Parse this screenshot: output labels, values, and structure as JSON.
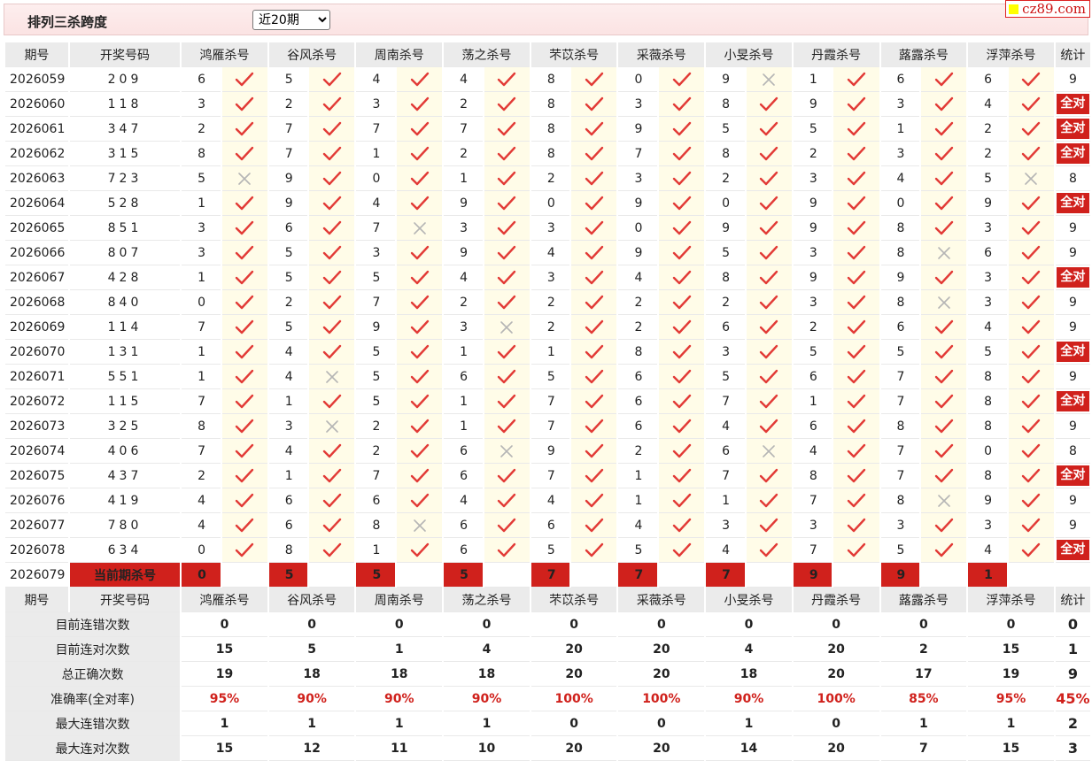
{
  "header": {
    "title": "排列三杀跨度",
    "period_select": "近20期",
    "logo_text": "cz89.com"
  },
  "columns": {
    "period": "期号",
    "open": "开奖号码",
    "experts": [
      "鸿雁杀号",
      "谷风杀号",
      "周南杀号",
      "荡之杀号",
      "芣苡杀号",
      "采薇杀号",
      "小旻杀号",
      "丹霞杀号",
      "蕗露杀号",
      "浮萍杀号"
    ],
    "stat": "统计"
  },
  "rows": [
    {
      "period": "2026059",
      "open": "209",
      "nums": [
        "6",
        "5",
        "4",
        "4",
        "8",
        "0",
        "9",
        "1",
        "6",
        "6"
      ],
      "ok": [
        1,
        1,
        1,
        1,
        1,
        1,
        0,
        1,
        1,
        1
      ],
      "stat": "9"
    },
    {
      "period": "2026060",
      "open": "118",
      "nums": [
        "3",
        "2",
        "3",
        "2",
        "8",
        "3",
        "8",
        "9",
        "3",
        "4"
      ],
      "ok": [
        1,
        1,
        1,
        1,
        1,
        1,
        1,
        1,
        1,
        1
      ],
      "stat": "全对"
    },
    {
      "period": "2026061",
      "open": "347",
      "nums": [
        "2",
        "7",
        "7",
        "7",
        "8",
        "9",
        "5",
        "5",
        "1",
        "2"
      ],
      "ok": [
        1,
        1,
        1,
        1,
        1,
        1,
        1,
        1,
        1,
        1
      ],
      "stat": "全对"
    },
    {
      "period": "2026062",
      "open": "315",
      "nums": [
        "8",
        "7",
        "1",
        "2",
        "8",
        "7",
        "8",
        "2",
        "3",
        "2"
      ],
      "ok": [
        1,
        1,
        1,
        1,
        1,
        1,
        1,
        1,
        1,
        1
      ],
      "stat": "全对"
    },
    {
      "period": "2026063",
      "open": "723",
      "nums": [
        "5",
        "9",
        "0",
        "1",
        "2",
        "3",
        "2",
        "3",
        "4",
        "5"
      ],
      "ok": [
        0,
        1,
        1,
        1,
        1,
        1,
        1,
        1,
        1,
        0
      ],
      "stat": "8"
    },
    {
      "period": "2026064",
      "open": "528",
      "nums": [
        "1",
        "9",
        "4",
        "9",
        "0",
        "9",
        "0",
        "9",
        "0",
        "9"
      ],
      "ok": [
        1,
        1,
        1,
        1,
        1,
        1,
        1,
        1,
        1,
        1
      ],
      "stat": "全对"
    },
    {
      "period": "2026065",
      "open": "851",
      "nums": [
        "3",
        "6",
        "7",
        "3",
        "3",
        "0",
        "9",
        "9",
        "8",
        "3"
      ],
      "ok": [
        1,
        1,
        0,
        1,
        1,
        1,
        1,
        1,
        1,
        1
      ],
      "stat": "9"
    },
    {
      "period": "2026066",
      "open": "807",
      "nums": [
        "3",
        "5",
        "3",
        "9",
        "4",
        "9",
        "5",
        "3",
        "8",
        "6"
      ],
      "ok": [
        1,
        1,
        1,
        1,
        1,
        1,
        1,
        1,
        0,
        1
      ],
      "stat": "9"
    },
    {
      "period": "2026067",
      "open": "428",
      "nums": [
        "1",
        "5",
        "5",
        "4",
        "3",
        "4",
        "8",
        "9",
        "9",
        "3"
      ],
      "ok": [
        1,
        1,
        1,
        1,
        1,
        1,
        1,
        1,
        1,
        1
      ],
      "stat": "全对"
    },
    {
      "period": "2026068",
      "open": "840",
      "nums": [
        "0",
        "2",
        "7",
        "2",
        "2",
        "2",
        "2",
        "3",
        "8",
        "3"
      ],
      "ok": [
        1,
        1,
        1,
        1,
        1,
        1,
        1,
        1,
        0,
        1
      ],
      "stat": "9"
    },
    {
      "period": "2026069",
      "open": "114",
      "nums": [
        "7",
        "5",
        "9",
        "3",
        "2",
        "2",
        "6",
        "2",
        "6",
        "4"
      ],
      "ok": [
        1,
        1,
        1,
        0,
        1,
        1,
        1,
        1,
        1,
        1
      ],
      "stat": "9"
    },
    {
      "period": "2026070",
      "open": "131",
      "nums": [
        "1",
        "4",
        "5",
        "1",
        "1",
        "8",
        "3",
        "5",
        "5",
        "5"
      ],
      "ok": [
        1,
        1,
        1,
        1,
        1,
        1,
        1,
        1,
        1,
        1
      ],
      "stat": "全对"
    },
    {
      "period": "2026071",
      "open": "551",
      "nums": [
        "1",
        "4",
        "5",
        "6",
        "5",
        "6",
        "5",
        "6",
        "7",
        "8"
      ],
      "ok": [
        1,
        0,
        1,
        1,
        1,
        1,
        1,
        1,
        1,
        1
      ],
      "stat": "9"
    },
    {
      "period": "2026072",
      "open": "115",
      "nums": [
        "7",
        "1",
        "5",
        "1",
        "7",
        "6",
        "7",
        "1",
        "7",
        "8"
      ],
      "ok": [
        1,
        1,
        1,
        1,
        1,
        1,
        1,
        1,
        1,
        1
      ],
      "stat": "全对"
    },
    {
      "period": "2026073",
      "open": "325",
      "nums": [
        "8",
        "3",
        "2",
        "1",
        "7",
        "6",
        "4",
        "6",
        "8",
        "8"
      ],
      "ok": [
        1,
        0,
        1,
        1,
        1,
        1,
        1,
        1,
        1,
        1
      ],
      "stat": "9"
    },
    {
      "period": "2026074",
      "open": "406",
      "nums": [
        "7",
        "4",
        "2",
        "6",
        "9",
        "2",
        "6",
        "4",
        "7",
        "0"
      ],
      "ok": [
        1,
        1,
        1,
        0,
        1,
        1,
        0,
        1,
        1,
        1
      ],
      "stat": "8"
    },
    {
      "period": "2026075",
      "open": "437",
      "nums": [
        "2",
        "1",
        "7",
        "6",
        "7",
        "1",
        "7",
        "8",
        "7",
        "8"
      ],
      "ok": [
        1,
        1,
        1,
        1,
        1,
        1,
        1,
        1,
        1,
        1
      ],
      "stat": "全对"
    },
    {
      "period": "2026076",
      "open": "419",
      "nums": [
        "4",
        "6",
        "6",
        "4",
        "4",
        "1",
        "1",
        "7",
        "8",
        "9"
      ],
      "ok": [
        1,
        1,
        1,
        1,
        1,
        1,
        1,
        1,
        0,
        1
      ],
      "stat": "9"
    },
    {
      "period": "2026077",
      "open": "780",
      "nums": [
        "4",
        "6",
        "8",
        "6",
        "6",
        "4",
        "3",
        "3",
        "3",
        "3"
      ],
      "ok": [
        1,
        1,
        0,
        1,
        1,
        1,
        1,
        1,
        1,
        1
      ],
      "stat": "9"
    },
    {
      "period": "2026078",
      "open": "634",
      "nums": [
        "0",
        "8",
        "1",
        "6",
        "5",
        "5",
        "4",
        "7",
        "5",
        "4"
      ],
      "ok": [
        1,
        1,
        1,
        1,
        1,
        1,
        1,
        1,
        1,
        1
      ],
      "stat": "全对"
    }
  ],
  "current": {
    "period": "2026079",
    "label": "当前期杀号",
    "kills": [
      "0",
      "5",
      "5",
      "5",
      "7",
      "7",
      "7",
      "9",
      "9",
      "1"
    ]
  },
  "stats_rows": [
    {
      "label": "目前连错次数",
      "values": [
        "0",
        "0",
        "0",
        "0",
        "0",
        "0",
        "0",
        "0",
        "0",
        "0"
      ],
      "total": "0",
      "red": false
    },
    {
      "label": "目前连对次数",
      "values": [
        "15",
        "5",
        "1",
        "4",
        "20",
        "20",
        "4",
        "20",
        "2",
        "15"
      ],
      "total": "1",
      "red": false
    },
    {
      "label": "总正确次数",
      "values": [
        "19",
        "18",
        "18",
        "18",
        "20",
        "20",
        "18",
        "20",
        "17",
        "19"
      ],
      "total": "9",
      "red": false
    },
    {
      "label": "准确率(全对率)",
      "values": [
        "95%",
        "90%",
        "90%",
        "90%",
        "100%",
        "100%",
        "90%",
        "100%",
        "85%",
        "95%"
      ],
      "total": "45%",
      "red": true
    },
    {
      "label": "最大连错次数",
      "values": [
        "1",
        "1",
        "1",
        "1",
        "0",
        "0",
        "1",
        "0",
        "1",
        "1"
      ],
      "total": "2",
      "red": false
    },
    {
      "label": "最大连对次数",
      "values": [
        "15",
        "12",
        "11",
        "10",
        "20",
        "20",
        "14",
        "20",
        "7",
        "15"
      ],
      "total": "3",
      "red": false
    }
  ],
  "colors": {
    "accent_red": "#d0211c",
    "value_blue": "#1a33c4",
    "header_gray": "#ebebeb",
    "mark_bg": "#fffce8"
  }
}
